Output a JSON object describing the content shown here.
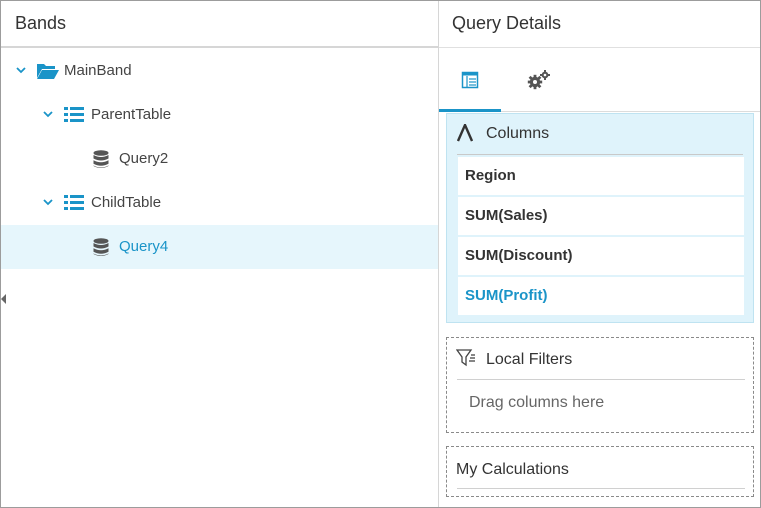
{
  "left_panel": {
    "title": "Bands",
    "tree": [
      {
        "label": "MainBand",
        "icon": "folder-open-icon",
        "expanded": true
      },
      {
        "label": "ParentTable",
        "icon": "table-list-icon",
        "expanded": true
      },
      {
        "label": "Query2",
        "icon": "database-icon"
      },
      {
        "label": "ChildTable",
        "icon": "table-list-icon",
        "expanded": true
      },
      {
        "label": "Query4",
        "icon": "database-icon",
        "selected": true
      }
    ]
  },
  "right_panel": {
    "title": "Query Details",
    "tabs": [
      {
        "icon": "query-table-icon",
        "active": true
      },
      {
        "icon": "gears-icon",
        "active": false
      }
    ],
    "columns_section": {
      "title": "Columns",
      "items": [
        "Region",
        "SUM(Sales)",
        "SUM(Discount)",
        "SUM(Profit)"
      ],
      "highlighted_item": "SUM(Profit)"
    },
    "filters_section": {
      "title": "Local Filters",
      "hint": "Drag columns here"
    },
    "calculations_section": {
      "title": "My Calculations"
    }
  },
  "colors": {
    "accent": "#1a94c8",
    "selected_bg": "#e6f6fc",
    "columns_bg": "#dff3fb"
  }
}
